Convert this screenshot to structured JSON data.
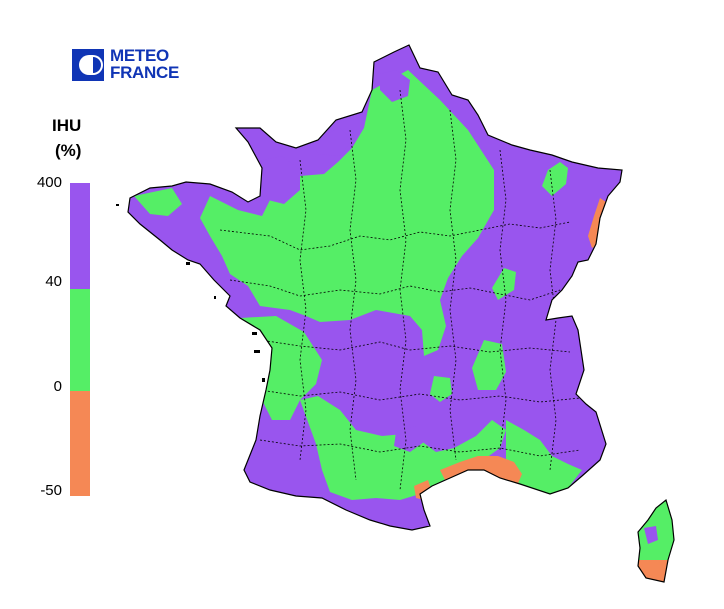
{
  "logo": {
    "line1": "METEO",
    "line2": "FRANCE",
    "color": "#1035b5"
  },
  "legend": {
    "title_line1": "IHU",
    "title_line2": "(%)",
    "ticks": [
      "400",
      "40",
      "0",
      "-50"
    ],
    "classes": [
      {
        "label": "40 to 400",
        "color": "#9955ee"
      },
      {
        "label": "0 to 40",
        "color": "#55ee66"
      },
      {
        "label": "-50 to 0",
        "color": "#f58855"
      }
    ]
  },
  "map": {
    "background_color": "#ffffff",
    "border_color": "#000000"
  }
}
